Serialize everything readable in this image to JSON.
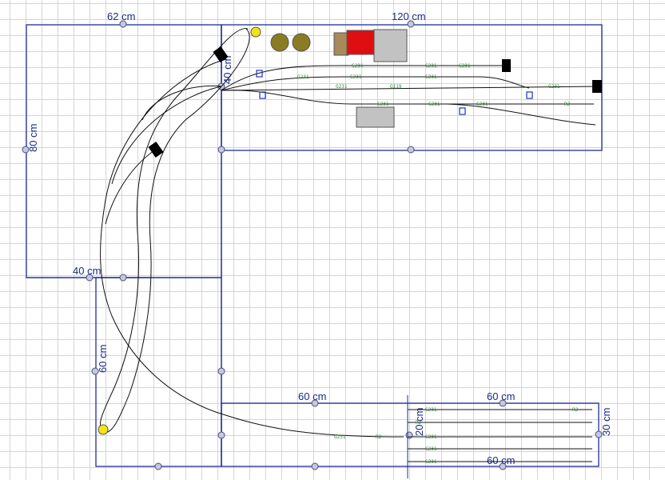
{
  "window": {
    "title": ""
  },
  "colors": {
    "board": "#1f2e9a",
    "track": "#111111",
    "track_marker": "#2f8a3a",
    "grid": "#d4d4d4",
    "signal": "#000000",
    "building_red": "#dd0f12",
    "building_grey": "#c2c2c2",
    "building_brown": "#a88a5a",
    "tank": "#8a7c22",
    "turntable_end": "#f4e40c"
  },
  "dimensions": {
    "top_left_width": "62 cm",
    "top_right_width": "120 cm",
    "left_height": "80 cm",
    "corner_small": "40 cm",
    "left_mid": "40 cm",
    "lower_left_height": "60 cm",
    "bottom_width_a": "60 cm",
    "bottom_width_b": "60 cm",
    "bottom_width_c": "60 cm",
    "right_small_a": "20 cm",
    "right_small_b": "30 cm"
  },
  "track_codes": {
    "straight": "G231",
    "short": "G119",
    "curve": "R2",
    "end": "R9"
  }
}
